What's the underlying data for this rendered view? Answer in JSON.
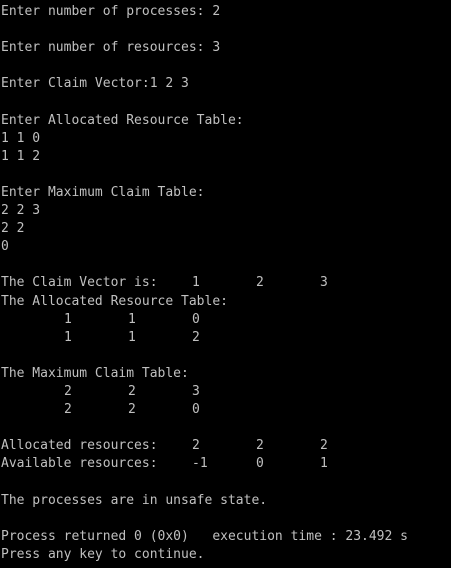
{
  "console": {
    "prompt_processes": "Enter number of processes: 2",
    "prompt_resources": "Enter number of resources: 3",
    "prompt_claim_vector": "Enter Claim Vector:1 2 3",
    "prompt_allocated": "Enter Allocated Resource Table:",
    "input_allocated": [
      "1 1 0",
      "1 1 2"
    ],
    "prompt_maximum": "Enter Maximum Claim Table:",
    "input_maximum": [
      "2 2 3",
      "2 2",
      "0"
    ],
    "claim_vector_label": "The Claim Vector is:",
    "claim_vector": [
      "1",
      "2",
      "3"
    ],
    "allocated_table_label": "The Allocated Resource Table:",
    "allocated_table": [
      [
        "1",
        "1",
        "0"
      ],
      [
        "1",
        "1",
        "2"
      ]
    ],
    "maximum_table_label": "The Maximum Claim Table:",
    "maximum_table": [
      [
        "2",
        "2",
        "3"
      ],
      [
        "2",
        "2",
        "0"
      ]
    ],
    "allocated_resources_label": "Allocated resources:",
    "allocated_resources": [
      "2",
      "2",
      "2"
    ],
    "available_resources_label": "Available resources:",
    "available_resources": [
      "-1",
      "0",
      "1"
    ],
    "state_message": "The processes are in unsafe state.",
    "process_returned": "Process returned 0 (0x0)   execution time : 23.492 s",
    "press_key": "Press any key to continue."
  },
  "colors": {
    "background": "#000000",
    "text": "#c0c0c0"
  }
}
